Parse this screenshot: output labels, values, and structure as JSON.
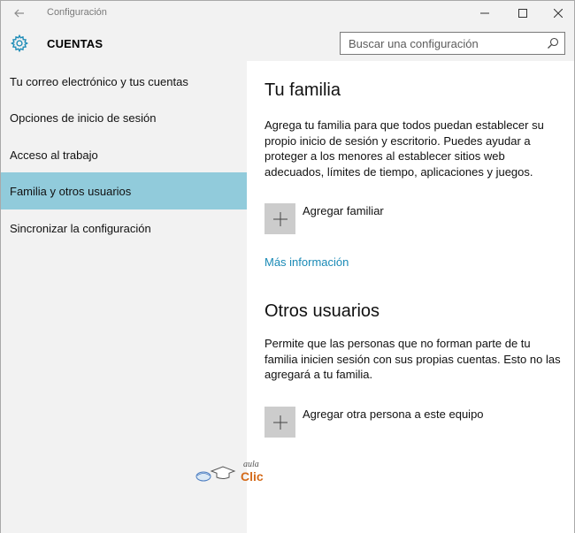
{
  "window": {
    "title": "Configuración",
    "back_icon": "arrow-left-icon",
    "controls": [
      "minimize-icon",
      "maximize-icon",
      "close-icon"
    ]
  },
  "header": {
    "icon": "gear-icon",
    "title": "CUENTAS",
    "search_placeholder": "Buscar una configuración",
    "search_icon": "search-icon"
  },
  "sidebar": {
    "items": [
      {
        "label": "Tu correo electrónico y tus cuentas",
        "active": false
      },
      {
        "label": "Opciones de inicio de sesión",
        "active": false
      },
      {
        "label": "Acceso al trabajo",
        "active": false
      },
      {
        "label": "Familia y otros usuarios",
        "active": true
      },
      {
        "label": "Sincronizar la configuración",
        "active": false
      }
    ]
  },
  "main": {
    "family": {
      "title": "Tu familia",
      "description": "Agrega tu familia para que todos puedan establecer su propio inicio de sesión y escritorio. Puedes ayudar a proteger a los menores al establecer sitios web adecuados, límites de tiempo, aplicaciones y juegos.",
      "add_label": "Agregar familiar",
      "more_info": "Más información"
    },
    "others": {
      "title": "Otros usuarios",
      "description": "Permite que las personas que no forman parte de tu familia inicien sesión con sus propias cuentas. Esto no las agregará a tu familia.",
      "add_label": "Agregar otra persona a este equipo"
    }
  },
  "watermark": {
    "line1": "aula",
    "line2": "Clic"
  },
  "colors": {
    "accent": "#91cbdb",
    "link": "#1a8ab6",
    "sidebar_bg": "#f2f2f2",
    "gear": "#1a8ab6"
  }
}
